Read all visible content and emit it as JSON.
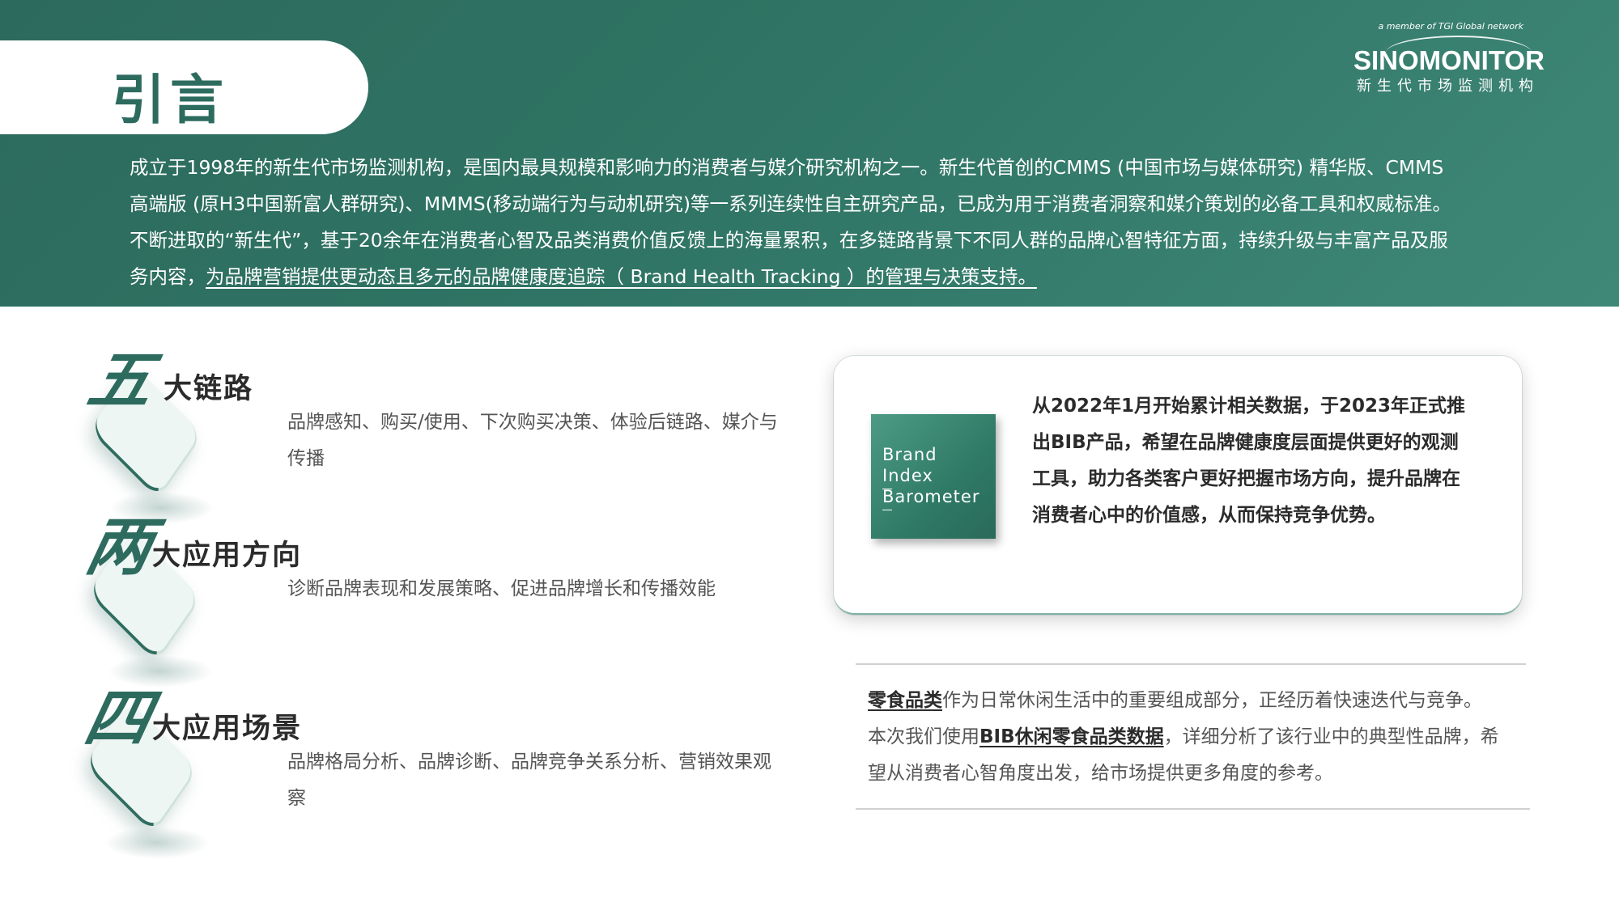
{
  "page": {
    "title": "引言"
  },
  "logo": {
    "top_text": "a member of TGI Global network",
    "main": "SINOMONITOR",
    "sub": "新生代市场监测机构"
  },
  "intro": {
    "line1": "成立于1998年的新生代市场监测机构，是国内最具规模和影响力的消费者与媒介研究机构之一。新生代首创的CMMS (中国市场与媒体研究) 精华版、CMMS",
    "line2": "高端版 (原H3中国新富人群研究)、MMMS(移动端行为与动机研究)等一系列连续性自主研究产品，已成为用于消费者洞察和媒介策划的必备工具和权威标准。",
    "line3": "不断进取的“新生代”，基于20余年在消费者心智及品类消费价值反馈上的海量累积，在多链路背景下不同人群的品牌心智特征方面，持续升级与丰富产品及服",
    "line4_prefix": "务内容，",
    "line4_highlight": "为品牌营销提供更动态且多元的品牌健康度追踪（ Brand Health Tracking ）的管理与决策支持。"
  },
  "sections": [
    {
      "num": "五",
      "title": "大链路",
      "desc": "品牌感知、购买/使用、下次购买决策、体验后链路、媒介与传播"
    },
    {
      "num": "两",
      "title": "大应用方向",
      "desc": "诊断品牌表现和发展策略、促进品牌增长和传播效能"
    },
    {
      "num": "四",
      "title": "大应用场景",
      "desc": "品牌格局分析、品牌诊断、品牌竞争关系分析、营销效果观察"
    }
  ],
  "card": {
    "logo_lines": [
      "Brand",
      "Index",
      "Barometer"
    ],
    "text": "从2022年1月开始累计相关数据，于2023年正式推出BIB产品，希望在品牌健康度层面提供更好的观测工具，助力各类客户更好把握市场方向，提升品牌在消费者心中的价值感，从而保持竞争优势。"
  },
  "snack": {
    "k1": "零食品类",
    "t1": "作为日常休闲生活中的重要组成部分，正经历着快速迭代与竞争。本次我们使用",
    "k2": "BIB休闲零食品类数据",
    "t2": "，详细分析了该行业中的典型性品牌，希望从消费者心智角度出发，给市场提供更多角度的参考。"
  },
  "colors": {
    "brand": "#2f7464",
    "title": "#2d6b5f"
  }
}
